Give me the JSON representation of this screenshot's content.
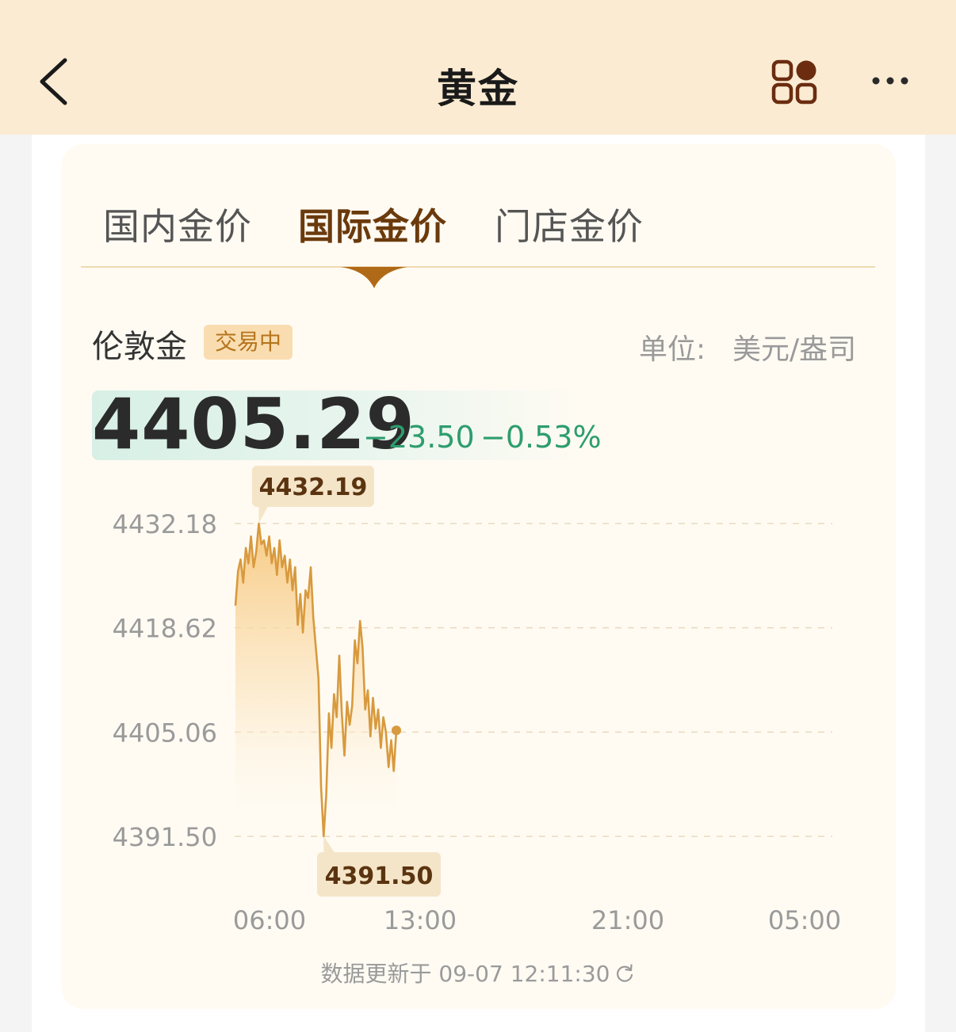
{
  "header": {
    "title": "黄金"
  },
  "tabs": [
    {
      "label": "国内金价",
      "active": false
    },
    {
      "label": "国际金价",
      "active": true
    },
    {
      "label": "门店金价",
      "active": false
    }
  ],
  "market": {
    "name": "伦敦金",
    "status": "交易中",
    "unit_label": "单位:",
    "unit_value": "美元/盎司"
  },
  "quote": {
    "price": "4405.29",
    "change": "−23.50",
    "change_percent": "−0.53%"
  },
  "chart_data": {
    "type": "area",
    "y_ticks": [
      "4432.18",
      "4418.62",
      "4405.06",
      "4391.50"
    ],
    "x_ticks": [
      "06:00",
      "13:00",
      "21:00",
      "05:00"
    ],
    "ylim": [
      4391.5,
      4432.18
    ],
    "grid": true,
    "high_label": "4432.19",
    "low_label": "4391.50",
    "series": [
      {
        "values": [
          4421.5,
          4426.0,
          4427.5,
          4424.5,
          4429.0,
          4427.0,
          4430.5,
          4426.5,
          4428.5,
          4432.19,
          4429.5,
          4430.0,
          4428.0,
          4430.5,
          4427.0,
          4429.0,
          4425.5,
          4430.0,
          4426.5,
          4428.0,
          4424.5,
          4427.5,
          4423.5,
          4426.5,
          4419.0,
          4423.0,
          4418.0,
          4423.5,
          4422.5,
          4426.5,
          4420.0,
          4416.0,
          4412.0,
          4398.0,
          4391.5,
          4397.0,
          4407.5,
          4403.0,
          4410.0,
          4407.0,
          4415.0,
          4407.5,
          4402.0,
          4409.0,
          4406.0,
          4408.5,
          4417.0,
          4414.0,
          4419.5,
          4416.0,
          4408.0,
          4410.5,
          4404.5,
          4409.5,
          4405.5,
          4408.0,
          4403.0,
          4407.0,
          4405.0,
          4400.5,
          4404.0,
          4400.0,
          4405.29
        ]
      }
    ]
  },
  "footer": {
    "update_text": "数据更新于 09-07 12:11:30"
  },
  "colors": {
    "nav_bg": "#fbebd2",
    "card_bg": "#fffbf3",
    "line": "#d89a3e",
    "fill_top": "#f7c77c",
    "down": "#2e9d6e",
    "active_tab": "#6b3a0c"
  }
}
